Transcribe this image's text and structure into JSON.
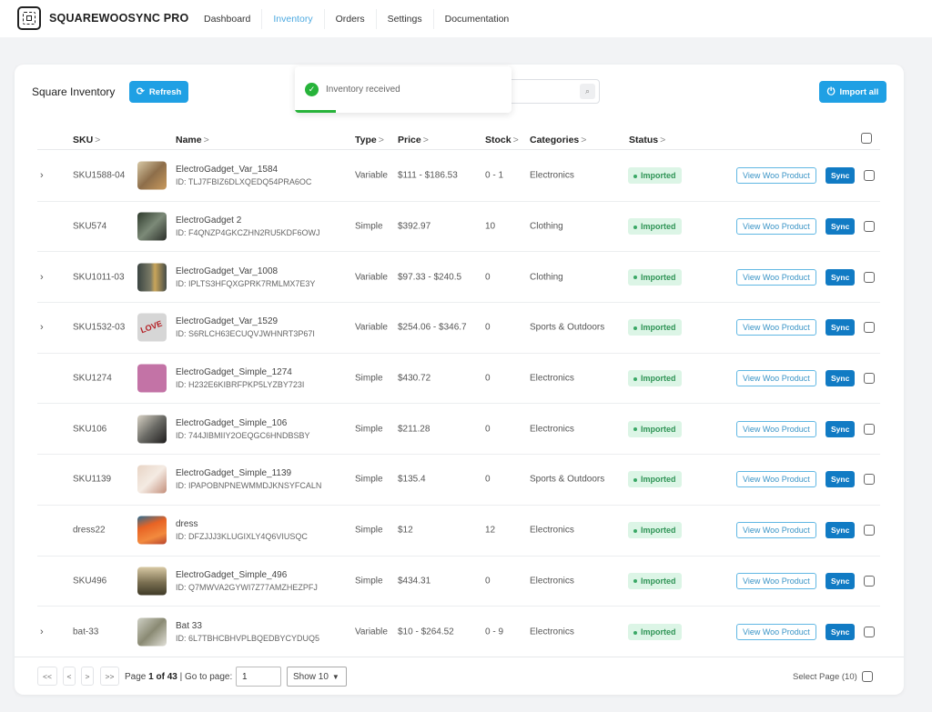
{
  "app": {
    "brand": "SQUAREWOOSYNC PRO",
    "nav": [
      {
        "label": "Dashboard",
        "active": false
      },
      {
        "label": "Inventory",
        "active": true
      },
      {
        "label": "Orders",
        "active": false
      },
      {
        "label": "Settings",
        "active": false
      },
      {
        "label": "Documentation",
        "active": false
      }
    ]
  },
  "card": {
    "title": "Square Inventory",
    "refresh_label": "Refresh",
    "import_all_label": "Import all",
    "search": {
      "value": "",
      "placeholder": ""
    }
  },
  "toast": {
    "message": "Inventory received",
    "progress_fraction": 0.19,
    "color": "#27b33a"
  },
  "table": {
    "columns": [
      "SKU",
      "Name",
      "Type",
      "Price",
      "Stock",
      "Categories",
      "Status"
    ],
    "sort_caret": ">",
    "rows": [
      {
        "expandable": true,
        "sku": "SKU1588-04",
        "name": "ElectroGadget_Var_1584",
        "id": "ID: TLJ7FBIZ6DLXQEDQ54PRA6OC",
        "type": "Variable",
        "price": "$111 - $186.53",
        "stock": "0 - 1",
        "category": "Electronics",
        "status": "Imported",
        "view_label": "View Woo Product",
        "sync_label": "Sync"
      },
      {
        "expandable": false,
        "sku": "SKU574",
        "name": "ElectroGadget 2",
        "id": "ID: F4QNZP4GKCZHN2RU5KDF6OWJ",
        "type": "Simple",
        "price": "$392.97",
        "stock": "10",
        "category": "Clothing",
        "status": "Imported",
        "view_label": "View Woo Product",
        "sync_label": "Sync"
      },
      {
        "expandable": true,
        "sku": "SKU1011-03",
        "name": "ElectroGadget_Var_1008",
        "id": "ID: IPLTS3HFQXGPRK7RMLMX7E3Y",
        "type": "Variable",
        "price": "$97.33 - $240.5",
        "stock": "0",
        "category": "Clothing",
        "status": "Imported",
        "view_label": "View Woo Product",
        "sync_label": "Sync"
      },
      {
        "expandable": true,
        "sku": "SKU1532-03",
        "name": "ElectroGadget_Var_1529",
        "id": "ID: S6RLCH63ECUQVJWHNRT3P67I",
        "type": "Variable",
        "price": "$254.06 - $346.7",
        "stock": "0",
        "category": "Sports & Outdoors",
        "status": "Imported",
        "view_label": "View Woo Product",
        "sync_label": "Sync"
      },
      {
        "expandable": false,
        "sku": "SKU1274",
        "name": "ElectroGadget_Simple_1274",
        "id": "ID: H232E6KIBRFPKP5LYZBY723I",
        "type": "Simple",
        "price": "$430.72",
        "stock": "0",
        "category": "Electronics",
        "status": "Imported",
        "view_label": "View Woo Product",
        "sync_label": "Sync"
      },
      {
        "expandable": false,
        "sku": "SKU106",
        "name": "ElectroGadget_Simple_106",
        "id": "ID: 744JIBMIIY2OEQGC6HNDBSBY",
        "type": "Simple",
        "price": "$211.28",
        "stock": "0",
        "category": "Electronics",
        "status": "Imported",
        "view_label": "View Woo Product",
        "sync_label": "Sync"
      },
      {
        "expandable": false,
        "sku": "SKU1139",
        "name": "ElectroGadget_Simple_1139",
        "id": "ID: IPAPOBNPNEWMMDJKNSYFCALN",
        "type": "Simple",
        "price": "$135.4",
        "stock": "0",
        "category": "Sports & Outdoors",
        "status": "Imported",
        "view_label": "View Woo Product",
        "sync_label": "Sync"
      },
      {
        "expandable": false,
        "sku": "dress22",
        "name": "dress",
        "id": "ID: DFZJJJ3KLUGIXLY4Q6VIUSQC",
        "type": "Simple",
        "price": "$12",
        "stock": "12",
        "category": "Electronics",
        "status": "Imported",
        "view_label": "View Woo Product",
        "sync_label": "Sync"
      },
      {
        "expandable": false,
        "sku": "SKU496",
        "name": "ElectroGadget_Simple_496",
        "id": "ID: Q7MWVA2GYWI7Z77AMZHEZPFJ",
        "type": "Simple",
        "price": "$434.31",
        "stock": "0",
        "category": "Electronics",
        "status": "Imported",
        "view_label": "View Woo Product",
        "sync_label": "Sync"
      },
      {
        "expandable": true,
        "sku": "bat-33",
        "name": "Bat 33",
        "id": "ID: 6L7TBHCBHVPLBQEDBYCYDUQ5",
        "type": "Variable",
        "price": "$10 - $264.52",
        "stock": "0 - 9",
        "category": "Electronics",
        "status": "Imported",
        "view_label": "View Woo Product",
        "sync_label": "Sync"
      }
    ],
    "love_thumb_text": "LOVE"
  },
  "pagination": {
    "first": "<<",
    "prev": "<",
    "next": ">",
    "last": ">>",
    "page_prefix": "Page",
    "page_current_of_total": "1 of 43",
    "goto_label": "| Go to page:",
    "goto_value": "1",
    "show_label": "Show 10",
    "select_page_label": "Select Page (10)"
  },
  "colors": {
    "accent": "#1fa0e4",
    "sync": "#117bc4",
    "status_bg": "#dcf5e6",
    "status_fg": "#2f9456",
    "nav_active": "#4ca9e0"
  }
}
